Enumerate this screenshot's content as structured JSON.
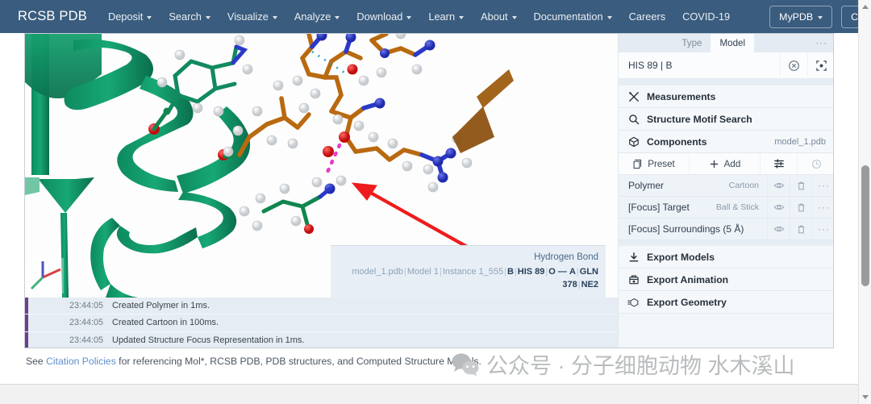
{
  "navbar": {
    "brand": "RCSB PDB",
    "items": [
      {
        "label": "Deposit",
        "caret": true
      },
      {
        "label": "Search",
        "caret": true
      },
      {
        "label": "Visualize",
        "caret": true
      },
      {
        "label": "Analyze",
        "caret": true
      },
      {
        "label": "Download",
        "caret": true
      },
      {
        "label": "Learn",
        "caret": true
      },
      {
        "label": "About",
        "caret": true
      },
      {
        "label": "Documentation",
        "caret": true
      },
      {
        "label": "Careers",
        "caret": false
      },
      {
        "label": "COVID-19",
        "caret": false
      }
    ],
    "mypdb": "MyPDB",
    "contact": "Contact us",
    "background": "#3a5c7e"
  },
  "viewer": {
    "tooltip": {
      "title": "Hydrogen Bond",
      "file": "model_1.pdb",
      "model": "Model 1",
      "instance": "Instance 1_555",
      "chain_b": "B",
      "residue_b": "HIS 89",
      "atom_b": "O",
      "dash": "—",
      "chain_a": "A",
      "residue_a": "GLN 378",
      "atom_a": "NE2"
    },
    "annotation": {
      "arrow_color": "#ee1c1c",
      "hbond_color": "#e63cc8"
    },
    "colors": {
      "cartoon": "#10845c",
      "ligand_carbon": "#c4701a",
      "nitrogen": "#2a39c8",
      "oxygen": "#d81515",
      "hydrogen": "#f2f2f2"
    }
  },
  "log": {
    "entries": [
      {
        "time": "23:44:05",
        "message": "Created Polymer in 1ms."
      },
      {
        "time": "23:44:05",
        "message": "Created Cartoon in 100ms."
      },
      {
        "time": "23:44:05",
        "message": "Updated Structure Focus Representation in 1ms."
      }
    ]
  },
  "panel": {
    "tabs": [
      {
        "label": "Type",
        "active": false
      },
      {
        "label": "Model",
        "active": true
      }
    ],
    "overflow": "···",
    "selection": {
      "label": "HIS 89 | B",
      "clear_icon": "circle-x-icon",
      "focus_icon": "crosshair-icon"
    },
    "sections": [
      {
        "id": "measurements",
        "label": "Measurements",
        "icon": "measure-icon",
        "side": ""
      },
      {
        "id": "structure-motif-search",
        "label": "Structure Motif Search",
        "icon": "search-icon",
        "side": ""
      },
      {
        "id": "components",
        "label": "Components",
        "icon": "cube-icon",
        "side": "model_1.pdb"
      }
    ],
    "toolbar": {
      "preset": "Preset",
      "add": "Add",
      "options_icon": "sliders-icon",
      "history_icon": "clock-icon"
    },
    "components": [
      {
        "name": "Polymer",
        "representation": "Cartoon"
      },
      {
        "name": "[Focus] Target",
        "representation": "Ball & Stick"
      },
      {
        "name": "[Focus] Surroundings (5 Å)",
        "representation": ""
      }
    ],
    "component_actions": {
      "visibility_icon": "eye-icon",
      "delete_icon": "trash-icon",
      "more_icon": "ellipsis-icon"
    },
    "exports": [
      {
        "id": "export-models",
        "label": "Export Models",
        "icon": "download-icon"
      },
      {
        "id": "export-animation",
        "label": "Export Animation",
        "icon": "film-icon"
      },
      {
        "id": "export-geometry",
        "label": "Export Geometry",
        "icon": "geometry-icon"
      }
    ]
  },
  "footer": {
    "citation_prefix": "See ",
    "citation_link": "Citation Policies",
    "citation_suffix": " for referencing Mol*, RCSB PDB, PDB structures, and Computed Structure Models.",
    "watermark": "公众号 · 分子细胞动物 水木溪山"
  }
}
